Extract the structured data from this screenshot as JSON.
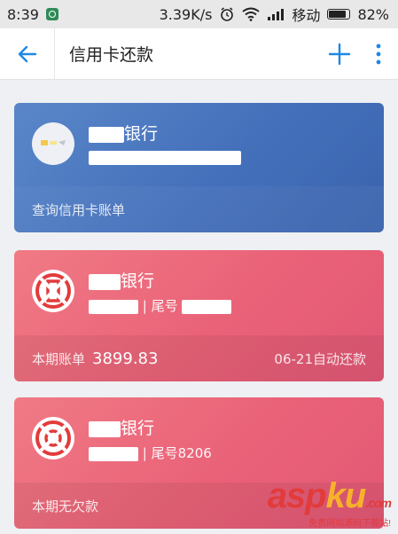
{
  "status": {
    "time": "8:39",
    "speed": "3.39K/s",
    "carrier": "移动",
    "battery": "82%"
  },
  "appbar": {
    "title": "信用卡还款"
  },
  "cards": [
    {
      "bank_name_visible": "银行",
      "footer_left": "查询信用卡账单"
    },
    {
      "bank_name_visible": "银行",
      "tail_label": "| 尾号",
      "footer_left": "本期账单",
      "bill_amount": "3899.83",
      "footer_right": "06-21自动还款"
    },
    {
      "bank_name_visible": "银行",
      "tail_label": "| 尾号8206",
      "footer_left": "本期无欠款"
    }
  ],
  "watermark": {
    "part_a": "asp",
    "part_b": "ku",
    "suffix": ".com",
    "sub": "免费网站源码下载站!"
  },
  "colors": {
    "blue_card": "#4a76c0",
    "red_card": "#ea6278",
    "accent": "#2196f3"
  }
}
